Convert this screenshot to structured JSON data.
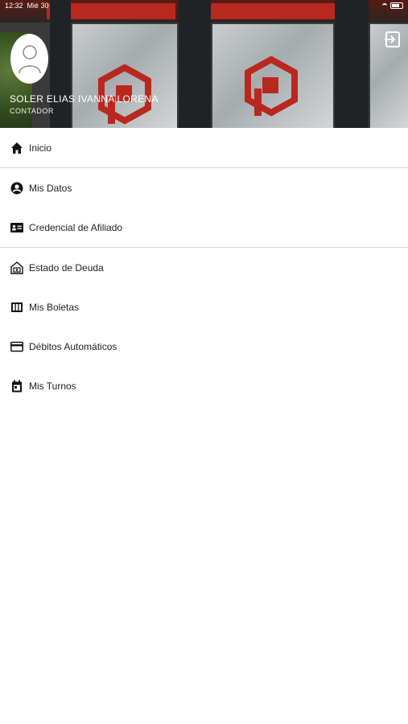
{
  "status": {
    "time": "12:32",
    "date": "Mié 30"
  },
  "profile": {
    "name": "SOLER ELIAS IVANNA LORENA",
    "role": "CONTADOR"
  },
  "menu": {
    "inicio": "Inicio",
    "mis_datos": "Mis Datos",
    "credencial": "Credencial de Afiliado",
    "estado_deuda": "Estado de Deuda",
    "mis_boletas": "Mis Boletas",
    "debitos": "Débitos Automáticos",
    "mis_turnos": "Mis Turnos"
  },
  "colors": {
    "brand_red": "#b9281f",
    "text": "#1e1e1e",
    "divider": "#d8d8d8"
  }
}
